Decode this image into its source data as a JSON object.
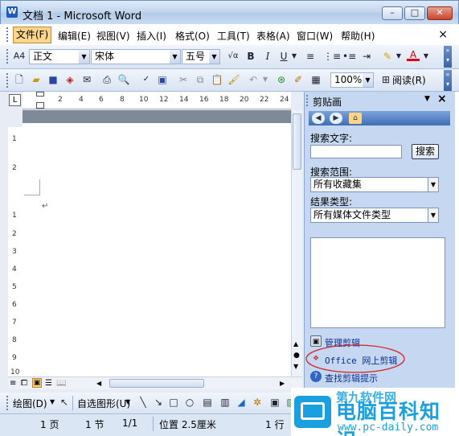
{
  "window": {
    "title": "文档 1 - Microsoft Word",
    "app_icon": "W",
    "minimize": "–",
    "maximize": "□",
    "close": "✕"
  },
  "menubar": {
    "items": [
      "文件(F)",
      "编辑(E)",
      "视图(V)",
      "插入(I)",
      "格式(O)",
      "工具(T)",
      "表格(A)",
      "窗口(W)",
      "帮助(H)"
    ],
    "doc_close": "×"
  },
  "formatting": {
    "style": "正文",
    "font": "宋体",
    "size": "五号",
    "bold": "B",
    "italic": "I",
    "underline": "U",
    "font_color": "A"
  },
  "standard": {
    "zoom": "100%",
    "read_label": "阅读(R)"
  },
  "ruler": {
    "ticks": [
      "2",
      "4",
      "6",
      "8",
      "10",
      "12",
      "14",
      "16",
      "18",
      "20",
      "22",
      "24"
    ],
    "vticks": [
      "1",
      "2",
      "1",
      "2",
      "3",
      "4",
      "5",
      "6",
      "7",
      "8",
      "9",
      "10"
    ]
  },
  "document": {
    "para_mark": "↵"
  },
  "task_pane": {
    "title": "剪贴画",
    "search_label": "搜索文字:",
    "search_value": "",
    "search_button": "搜索",
    "scope_label": "搜索范围:",
    "scope_value": "所有收藏集",
    "type_label": "结果类型:",
    "type_value": "所有媒体文件类型",
    "links": [
      "管理剪辑...",
      "Office 网上剪辑",
      "查找剪辑提示"
    ]
  },
  "drawing": {
    "draw_label": "绘图(D)",
    "autoshapes_label": "自选图形(U)"
  },
  "status": {
    "page": "1 页",
    "section": "1 节",
    "pages": "1/1",
    "position": "位置 2.5厘米",
    "line": "1 行"
  },
  "watermark": {
    "brand": "电脑百科知识",
    "url": "www.pc-daily.com",
    "top": "第九软件网"
  },
  "colors": {
    "menu_highlight": "#fbd68a",
    "pane_bg": "#c6d8f1",
    "brand": "#1aa0df",
    "annotation_circle": "#d42424"
  }
}
